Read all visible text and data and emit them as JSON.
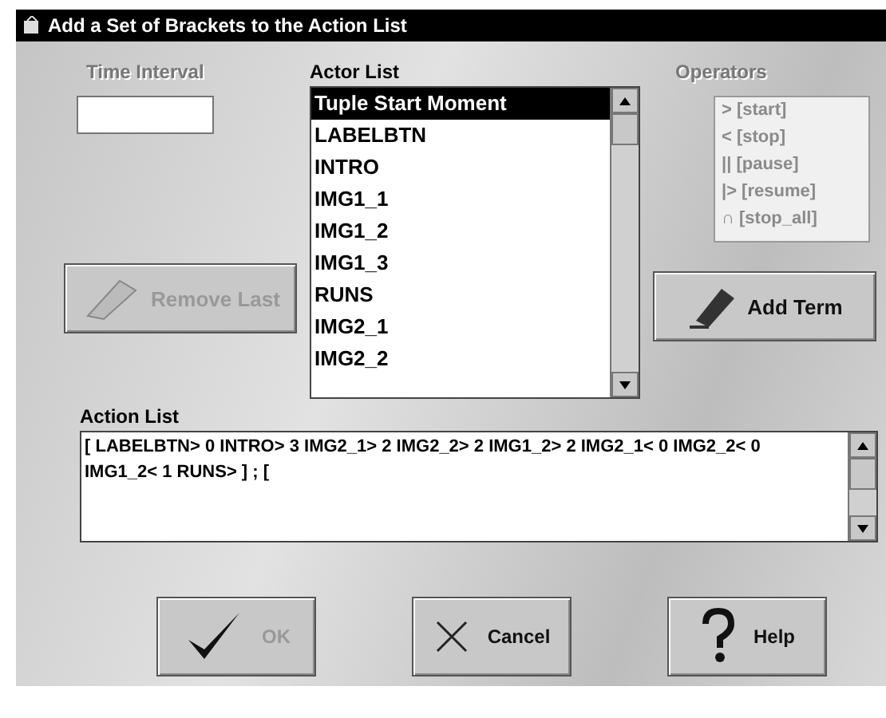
{
  "window": {
    "title": "Add a Set of Brackets to the Action List"
  },
  "time_interval": {
    "label": "Time Interval",
    "disabled": true
  },
  "actor_list": {
    "label": "Actor List",
    "items": [
      {
        "text": "Tuple Start Moment",
        "selected": true
      },
      {
        "text": "LABELBTN",
        "selected": false
      },
      {
        "text": "INTRO",
        "selected": false
      },
      {
        "text": "IMG1_1",
        "selected": false
      },
      {
        "text": "IMG1_2",
        "selected": false
      },
      {
        "text": "IMG1_3",
        "selected": false
      },
      {
        "text": "RUNS",
        "selected": false
      },
      {
        "text": "IMG2_1",
        "selected": false
      },
      {
        "text": "IMG2_2",
        "selected": false
      }
    ]
  },
  "operators": {
    "label": "Operators",
    "disabled": true,
    "items": [
      "> [start]",
      "<  [stop]",
      "|| [pause]",
      "|> [resume]",
      "∩ [stop_all]"
    ]
  },
  "remove_last": {
    "label": "Remove Last",
    "disabled": true
  },
  "add_term": {
    "label": "Add Term",
    "disabled": false
  },
  "action_list": {
    "label": "Action List",
    "value": "[ LABELBTN> 0 INTRO> 3 IMG2_1> 2 IMG2_2> 2 IMG1_2> 2 IMG2_1< 0 IMG2_2< 0 IMG1_2< 1 RUNS> ] ; ["
  },
  "buttons": [
    {
      "kind": "ok",
      "label": "OK",
      "disabled": true
    },
    {
      "kind": "cancel",
      "label": "Cancel",
      "disabled": false
    },
    {
      "kind": "help",
      "label": "Help",
      "disabled": false
    }
  ]
}
